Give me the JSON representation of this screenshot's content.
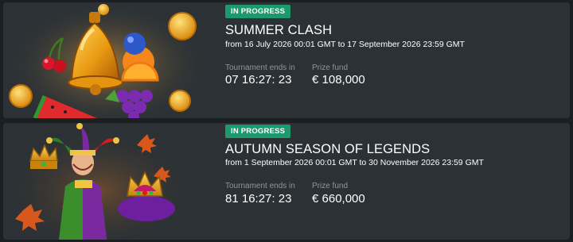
{
  "tournaments": [
    {
      "status": "IN PROGRESS",
      "title": "SUMMER CLASH",
      "dates": "from 16 July 2026 00:01 GMT to 17 September 2026 23:59 GMT",
      "ends_label": "Tournament ends in",
      "ends_value": "07 16:27: 23",
      "prize_label": "Prize fund",
      "prize_value": "€ 108,000",
      "art": "bell-fruits-illustration"
    },
    {
      "status": "IN PROGRESS",
      "title": "AUTUMN SEASON OF LEGENDS",
      "dates": "from 1 September 2026 00:01 GMT to 30 November 2026 23:59 GMT",
      "ends_label": "Tournament ends in",
      "ends_value": "81 16:27: 23",
      "prize_label": "Prize fund",
      "prize_value": "€ 660,000",
      "art": "jester-crowns-illustration"
    }
  ],
  "colors": {
    "page_bg": "#1b1f22",
    "card_bg": "#2b3135",
    "badge_bg": "#1c9a6e",
    "muted_text": "#8e979d"
  }
}
